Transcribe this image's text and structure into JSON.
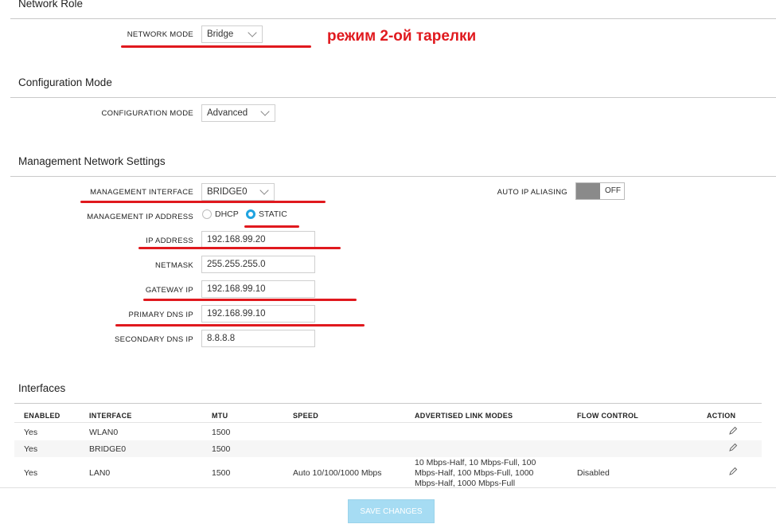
{
  "annotation": {
    "text": "режим 2-ой тарелки",
    "color": "#e0191e"
  },
  "network_role": {
    "title": "Network Role",
    "mode_label": "NETWORK MODE",
    "mode_value": "Bridge"
  },
  "configuration": {
    "title": "Configuration Mode",
    "mode_label": "CONFIGURATION MODE",
    "mode_value": "Advanced"
  },
  "management": {
    "title": "Management Network Settings",
    "interface_label": "MANAGEMENT INTERFACE",
    "interface_value": "BRIDGE0",
    "aliasing_label": "AUTO IP ALIASING",
    "aliasing_value": "OFF",
    "ip_mode_label": "MANAGEMENT IP ADDRESS",
    "ip_mode_options": [
      "DHCP",
      "STATIC"
    ],
    "ip_mode_selected": "STATIC",
    "ip_label": "IP ADDRESS",
    "ip_value": "192.168.99.20",
    "netmask_label": "NETMASK",
    "netmask_value": "255.255.255.0",
    "gateway_label": "GATEWAY IP",
    "gateway_value": "192.168.99.10",
    "dns1_label": "PRIMARY DNS IP",
    "dns1_value": "192.168.99.10",
    "dns2_label": "SECONDARY DNS IP",
    "dns2_value": "8.8.8.8"
  },
  "interfaces": {
    "title": "Interfaces",
    "columns": [
      "ENABLED",
      "INTERFACE",
      "MTU",
      "SPEED",
      "ADVERTISED LINK MODES",
      "FLOW CONTROL",
      "ACTION"
    ],
    "rows": [
      {
        "enabled": "Yes",
        "interface": "WLAN0",
        "mtu": "1500",
        "speed": "",
        "link_modes": [
          "",
          "",
          ""
        ],
        "flow": ""
      },
      {
        "enabled": "Yes",
        "interface": "BRIDGE0",
        "mtu": "1500",
        "speed": "",
        "link_modes": [
          "",
          "",
          ""
        ],
        "flow": ""
      },
      {
        "enabled": "Yes",
        "interface": "LAN0",
        "mtu": "1500",
        "speed": "Auto 10/100/1000 Mbps",
        "link_modes": [
          "10 Mbps-Half, 10 Mbps-Full, 100",
          "Mbps-Half, 100 Mbps-Full, 1000",
          "Mbps-Half, 1000 Mbps-Full"
        ],
        "flow": "Disabled"
      }
    ]
  },
  "save_button": "SAVE CHANGES"
}
